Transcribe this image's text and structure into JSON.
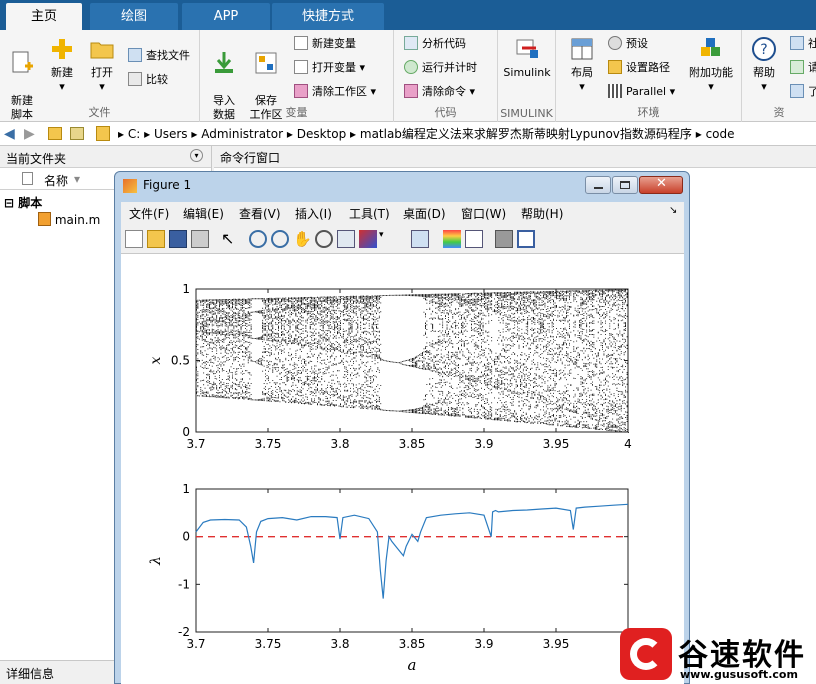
{
  "tabs": [
    {
      "label": "主页"
    },
    {
      "label": "绘图"
    },
    {
      "label": "APP"
    },
    {
      "label": "快捷方式"
    }
  ],
  "ribbon": {
    "file": {
      "label": "文件",
      "new_script": "新建\n脚本",
      "new": "新建",
      "open": "打开",
      "find_files": "查找文件",
      "compare": "比较"
    },
    "variable": {
      "label": "变量",
      "import": "导入\n数据",
      "save_ws": "保存\n工作区",
      "new_var": "新建变量",
      "open_var": "打开变量",
      "clear_ws": "清除工作区"
    },
    "code": {
      "label": "代码",
      "analyze": "分析代码",
      "run_time": "运行并计时",
      "clear_cmd": "清除命令"
    },
    "simulink": {
      "label": "SIMULINK",
      "btn": "Simulink"
    },
    "env": {
      "label": "环境",
      "layout": "布局",
      "prefs": "预设",
      "set_path": "设置路径",
      "parallel": "Parallel",
      "addons": "附加功能"
    },
    "resources": {
      "label": "资",
      "help": "帮助",
      "c1": "社",
      "c2": "请",
      "c3": "了"
    }
  },
  "address": {
    "path": [
      "C:",
      "Users",
      "Administrator",
      "Desktop",
      "matlab编程定义法来求解罗杰斯蒂映射Lypunov指数源码程序",
      "code"
    ]
  },
  "left_panel": {
    "title": "当前文件夹",
    "col_name": "名称",
    "folder": "脚本",
    "file": "main.m",
    "details": "详细信息"
  },
  "command_window": {
    "title": "命令行窗口"
  },
  "figure": {
    "title": "Figure 1",
    "menus": [
      "文件(F)",
      "编辑(E)",
      "查看(V)",
      "插入(I)",
      "工具(T)",
      "桌面(D)",
      "窗口(W)",
      "帮助(H)"
    ]
  },
  "chart_data": [
    {
      "type": "scatter",
      "xlim": [
        3.7,
        4
      ],
      "ylim": [
        0,
        1
      ],
      "xticks": [
        "3.7",
        "3.75",
        "3.8",
        "3.85",
        "3.9",
        "3.95",
        "4"
      ],
      "yticks": [
        "0",
        "0.5",
        "1"
      ],
      "ylabel": "x",
      "xlabel": ""
    },
    {
      "type": "line",
      "xlim": [
        3.7,
        4
      ],
      "ylim": [
        -2,
        1
      ],
      "xticks": [
        "3.7",
        "3.75",
        "3.8",
        "3.85",
        "3.9",
        "3.95"
      ],
      "yticks": [
        "-2",
        "-1",
        "0",
        "1"
      ],
      "ylabel": "λ",
      "xlabel": "a",
      "x": [
        3.7,
        3.705,
        3.71,
        3.72,
        3.73,
        3.735,
        3.738,
        3.74,
        3.742,
        3.745,
        3.75,
        3.76,
        3.77,
        3.78,
        3.79,
        3.798,
        3.8,
        3.802,
        3.81,
        3.82,
        3.826,
        3.828,
        3.83,
        3.832,
        3.834,
        3.836,
        3.84,
        3.844,
        3.846,
        3.85,
        3.854,
        3.856,
        3.86,
        3.87,
        3.88,
        3.89,
        3.9,
        3.905,
        3.906,
        3.908,
        3.91,
        3.92,
        3.93,
        3.94,
        3.95,
        3.96,
        3.962,
        3.964,
        3.97,
        3.98,
        3.99,
        4.0
      ],
      "y": [
        0.1,
        0.3,
        0.35,
        0.36,
        0.35,
        0.2,
        -0.2,
        -0.55,
        0.1,
        0.32,
        0.38,
        0.4,
        0.35,
        0.42,
        0.42,
        0.4,
        -0.05,
        0.4,
        0.45,
        0.38,
        0.1,
        -0.7,
        -1.3,
        -0.5,
        0.0,
        -0.1,
        -0.25,
        -0.4,
        -0.2,
        0.05,
        -0.1,
        0.1,
        0.4,
        0.45,
        0.48,
        0.5,
        0.45,
        0.0,
        0.52,
        0.55,
        0.52,
        0.55,
        0.56,
        0.58,
        0.6,
        0.55,
        0.15,
        0.6,
        0.62,
        0.64,
        0.66,
        0.68
      ],
      "refline": {
        "y": 0,
        "color": "#e03030",
        "style": "dashed"
      },
      "series_color": "#2a7bc0"
    }
  ],
  "watermark": {
    "text": "谷速软件",
    "url": "www.gususoft.com"
  }
}
